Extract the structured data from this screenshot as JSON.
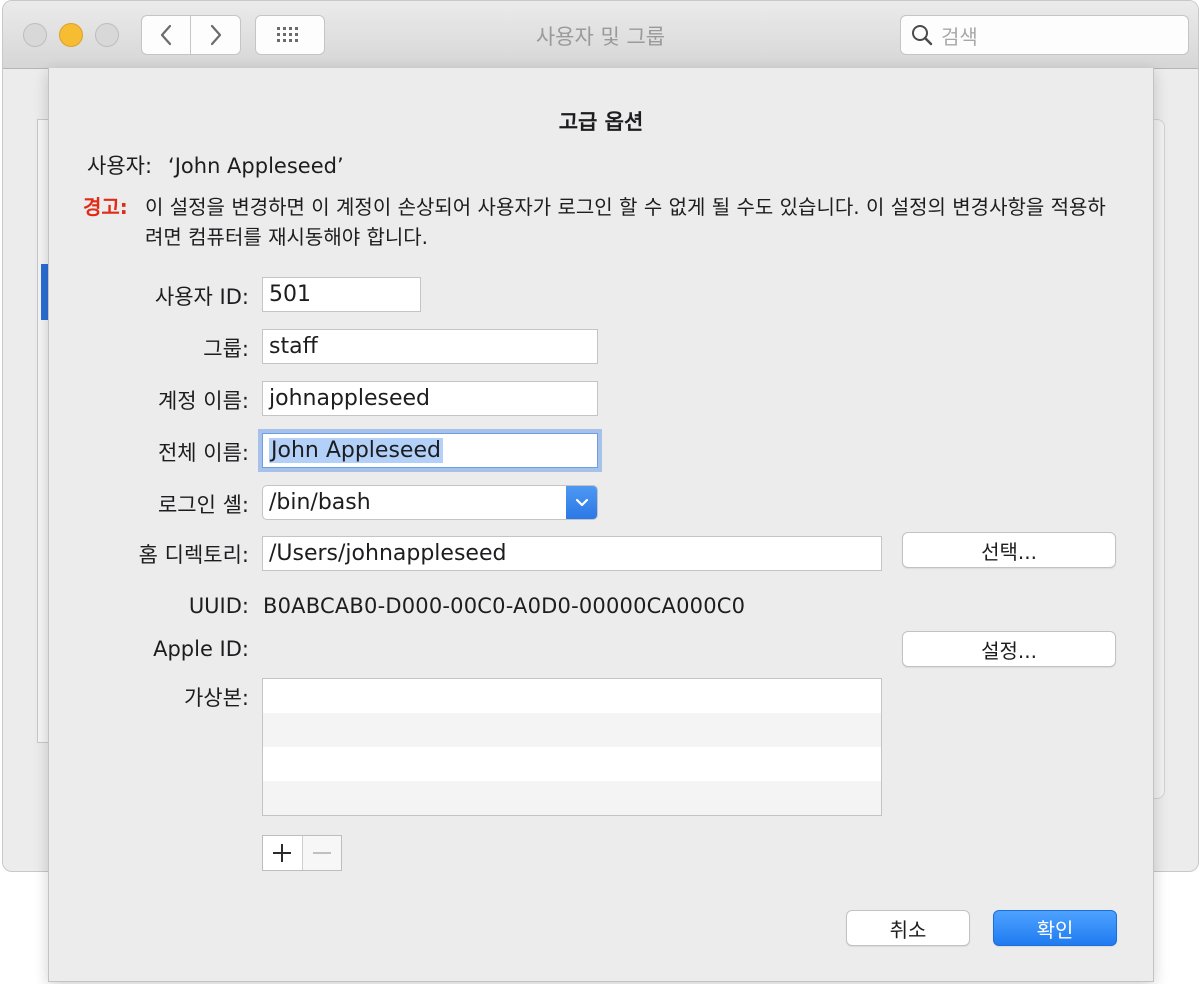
{
  "window": {
    "title": "사용자 및 그룹",
    "search_placeholder": "검색"
  },
  "sheet": {
    "title": "고급 옵션",
    "user_label": "사용자:",
    "user_value": "‘John Appleseed’",
    "warning_label": "경고:",
    "warning_text": "이 설정을 변경하면 이 계정이 손상되어 사용자가 로그인 할 수 없게 될 수도 있습니다. 이 설정의 변경사항을 적용하려면 컴퓨터를 재시동해야 합니다.",
    "fields": {
      "user_id": {
        "label": "사용자 ID:",
        "value": "501"
      },
      "group": {
        "label": "그룹:",
        "value": "staff"
      },
      "account_name": {
        "label": "계정 이름:",
        "value": "johnappleseed"
      },
      "full_name": {
        "label": "전체 이름:",
        "value": "John Appleseed"
      },
      "login_shell": {
        "label": "로그인 셸:",
        "value": "/bin/bash"
      },
      "home_directory": {
        "label": "홈 디렉토리:",
        "value": "/Users/johnappleseed",
        "button": "선택..."
      },
      "uuid": {
        "label": "UUID:",
        "value": "B0ABCAB0-D000-00C0-A0D0-00000CA000C0"
      },
      "apple_id": {
        "label": "Apple ID:",
        "value": "",
        "button": "설정..."
      },
      "aliases": {
        "label": "가상본:",
        "items": []
      }
    },
    "add_symbol": "+",
    "remove_symbol": "−",
    "cancel_label": "취소",
    "ok_label": "확인"
  },
  "colors": {
    "warning": "#e02b18",
    "accent": "#1f7bf0",
    "selection": "#b3d1f8"
  },
  "icons": [
    "back-chevron-icon",
    "forward-chevron-icon",
    "grid-icon",
    "search-icon",
    "popup-chevron-icon"
  ]
}
